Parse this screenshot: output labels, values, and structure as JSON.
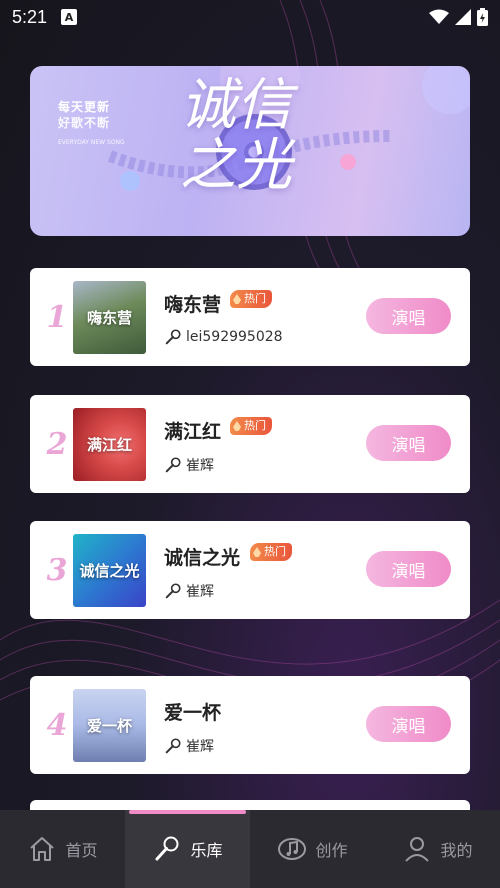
{
  "status_bar": {
    "time": "5:21",
    "notification_glyph": "A"
  },
  "banner": {
    "line1": "每天更新",
    "line2": "好歌不断",
    "small_text": "EVERYDAY NEW SONG",
    "title": "诚信之光"
  },
  "songs": [
    {
      "rank": "1",
      "title": "嗨东营",
      "hot_label": "热门",
      "artist": "lei592995028",
      "sing_label": "演唱",
      "cover_text": "嗨东营",
      "cover_colors": [
        "#6d8a5a",
        "#3e5a3a"
      ]
    },
    {
      "rank": "2",
      "title": "满江红",
      "hot_label": "热门",
      "artist": "崔辉",
      "sing_label": "演唱",
      "cover_text": "满江红",
      "cover_colors": [
        "#d84a4a",
        "#9b1e24"
      ]
    },
    {
      "rank": "3",
      "title": "诚信之光",
      "hot_label": "热门",
      "artist": "崔辉",
      "sing_label": "演唱",
      "cover_text": "诚信之光",
      "cover_colors": [
        "#21b3c8",
        "#3a43c8"
      ]
    },
    {
      "rank": "4",
      "title": "爱一杯",
      "hot_label": "",
      "artist": "崔辉",
      "sing_label": "演唱",
      "cover_text": "爱一杯",
      "cover_colors": [
        "#a9b9e6",
        "#6e7fb0"
      ]
    }
  ],
  "tabs": [
    {
      "label": "首页",
      "icon": "home-icon",
      "active": false
    },
    {
      "label": "乐库",
      "icon": "microphone-icon",
      "active": true
    },
    {
      "label": "创作",
      "icon": "music-note-icon",
      "active": false
    },
    {
      "label": "我的",
      "icon": "user-icon",
      "active": false
    }
  ],
  "colors": {
    "accent_pink": "#f08bc8",
    "hot_orange": "#e9563b",
    "rank_pink": "#e9a6d6",
    "tabbar_bg": "#2b2a30"
  }
}
